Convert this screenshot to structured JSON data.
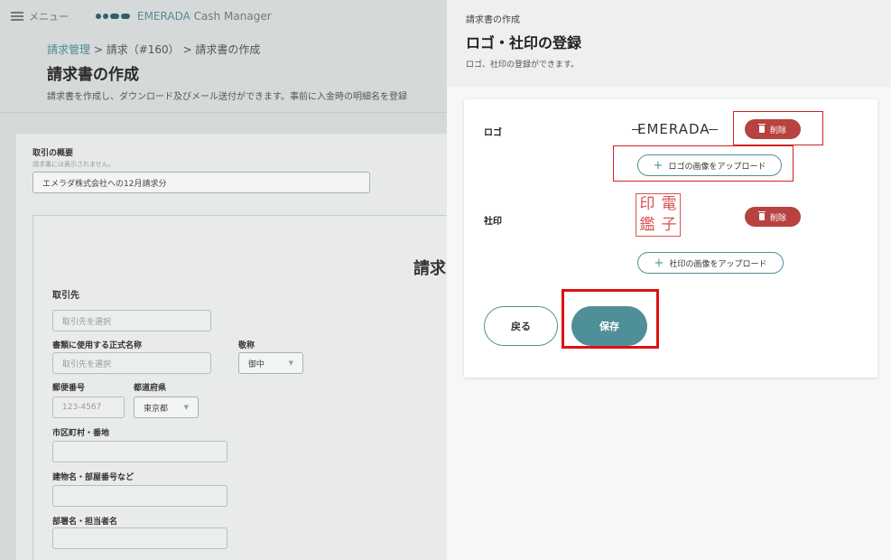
{
  "topbar": {
    "menu_label": "メニュー",
    "brand_name": "EMERADA",
    "brand_suffix": " Cash Manager"
  },
  "breadcrumb": {
    "item1": "請求管理",
    "sep1": " > ",
    "item2": "請求（#160）",
    "sep2": " > ",
    "item3": "請求書の作成"
  },
  "page": {
    "title": "請求書の作成",
    "description": "請求書を作成し、ダウンロード及びメール送付ができます。事前に入金時の明細名を登録"
  },
  "form": {
    "overview_label": "取引の概要",
    "overview_note": "請求書には表示されません。",
    "overview_value": "エメラダ株式会社への12月請求分",
    "doc_title": "請求",
    "client_section": "取引先",
    "client_placeholder": "取引先を選択",
    "official_name_label": "書類に使用する正式名称",
    "official_name_placeholder": "取引先を選択",
    "honorific_label": "敬称",
    "honorific_value": "御中",
    "postal_label": "郵便番号",
    "postal_placeholder": "123-4567",
    "prefecture_label": "都道府県",
    "prefecture_value": "東京都",
    "city_label": "市区町村・番地",
    "building_label": "建物名・部屋番号など",
    "dept_label": "部署名・担当者名",
    "dropdown_arrow": "▼"
  },
  "panel": {
    "subtitle": "請求書の作成",
    "title": "ロゴ・社印の登録",
    "description": "ロゴ、社印の登録ができます。",
    "logo_label": "ロゴ",
    "logo_image_text": "EMERADA",
    "logo_delete": "削除",
    "logo_upload": "ロゴの画像をアップロード",
    "seal_label": "社印",
    "seal_chars": [
      "印",
      "電",
      "鑑",
      "子"
    ],
    "seal_delete": "削除",
    "seal_upload": "社印の画像をアップロード",
    "back_label": "戻る",
    "save_label": "保存",
    "plus": "+"
  },
  "colors": {
    "accent": "#4f8f97",
    "danger": "#b7423f",
    "highlight": "#e01010"
  }
}
